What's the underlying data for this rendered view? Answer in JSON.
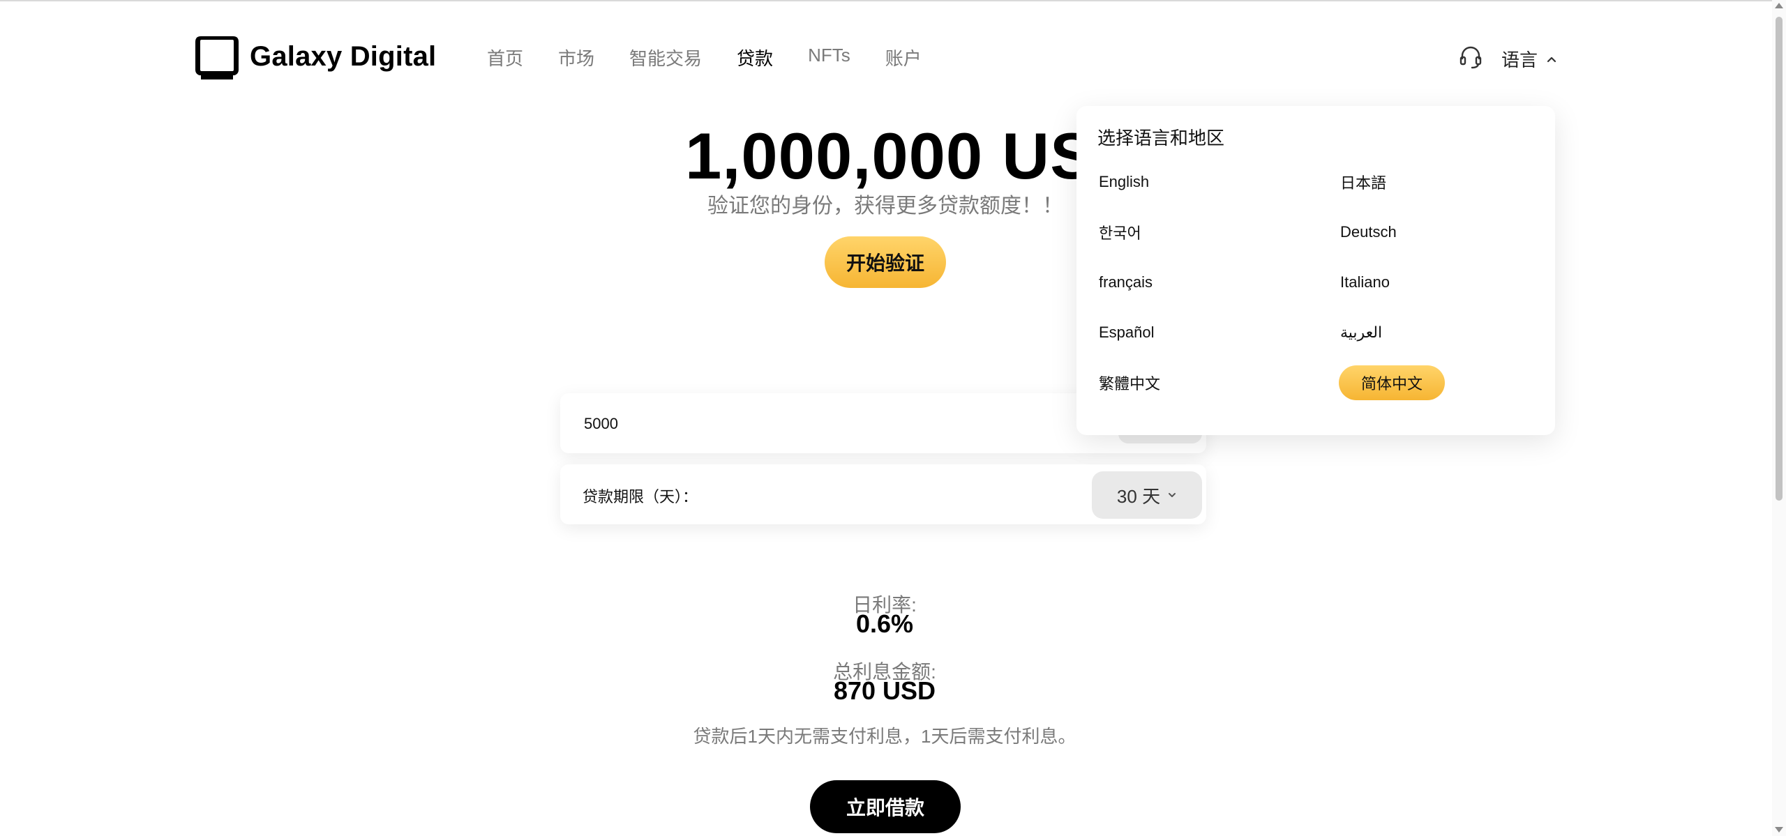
{
  "brand": {
    "name": "Galaxy Digital",
    "logo_icon": "monitor-frame-logo"
  },
  "nav": {
    "items": [
      {
        "label": "首页"
      },
      {
        "label": "市场"
      },
      {
        "label": "智能交易"
      },
      {
        "label": "贷款",
        "active": true
      },
      {
        "label": "NFTs"
      },
      {
        "label": "账户"
      }
    ]
  },
  "header": {
    "support_icon": "headset-icon",
    "language_label": "语言"
  },
  "hero": {
    "amount": "1,000,000 USD",
    "subtitle": "验证您的身份，获得更多贷款额度！！",
    "verify_button": "开始验证"
  },
  "form": {
    "amount_value": "5000",
    "term_label": "贷款期限（天）：",
    "term_value": "30 天"
  },
  "stats": {
    "daily_rate_label": "日利率:",
    "daily_rate_value": "0.6%",
    "total_interest_label": "总利息金额:",
    "total_interest_value": "870 USD"
  },
  "note": "贷款后1天内无需支付利息，1天后需支付利息。",
  "borrow_button": "立即借款",
  "language_panel": {
    "title": "选择语言和地区",
    "options": [
      "English",
      "日本語",
      "한국어",
      "Deutsch",
      "français",
      "Italiano",
      "Español",
      "العربية",
      "繁體中文",
      "简体中文"
    ],
    "selected": "简体中文"
  },
  "colors": {
    "accent": "#f6b533",
    "accent_light": "#ffd46a",
    "primary_button": "#000000",
    "muted_text": "#7a7a7a"
  }
}
